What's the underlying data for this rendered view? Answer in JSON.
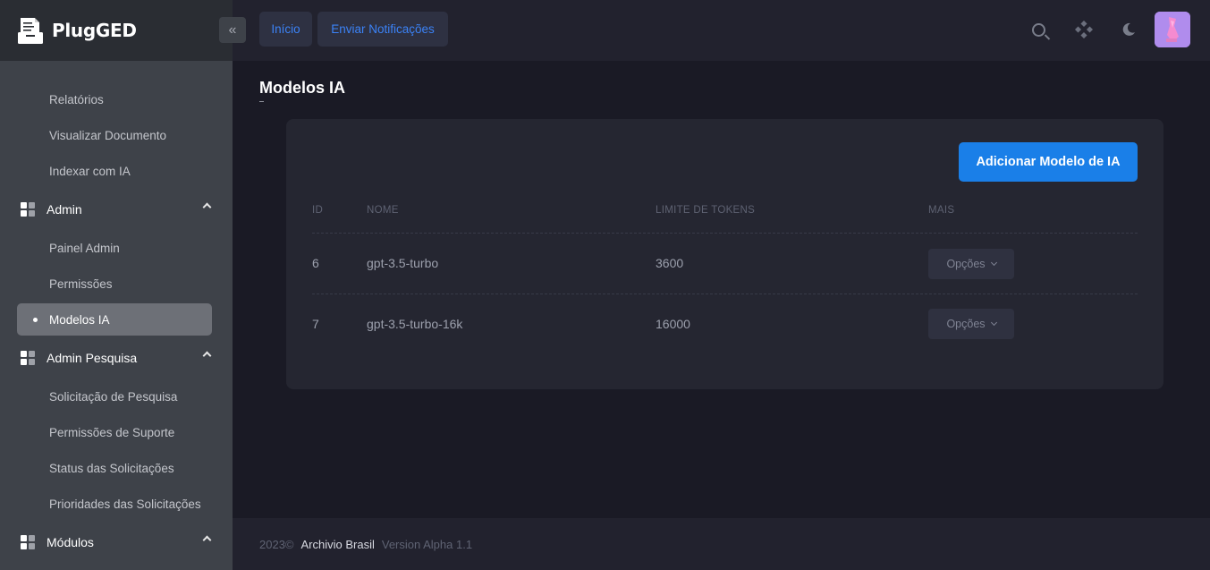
{
  "app": {
    "name": "PlugGED"
  },
  "header": {
    "nav": [
      "Início",
      "Enviar Notificações"
    ],
    "icons": [
      "search-icon",
      "apps-icon",
      "moon-icon",
      "avatar"
    ]
  },
  "sidebar": {
    "items": [
      {
        "type": "sub",
        "label": "Relatórios"
      },
      {
        "type": "sub",
        "label": "Visualizar Documento"
      },
      {
        "type": "sub",
        "label": "Indexar com IA"
      },
      {
        "type": "group",
        "label": "Admin"
      },
      {
        "type": "sub",
        "label": "Painel Admin"
      },
      {
        "type": "sub",
        "label": "Permissões"
      },
      {
        "type": "sub",
        "label": "Modelos IA",
        "active": true
      },
      {
        "type": "group",
        "label": "Admin Pesquisa"
      },
      {
        "type": "sub",
        "label": "Solicitação de Pesquisa"
      },
      {
        "type": "sub",
        "label": "Permissões de Suporte"
      },
      {
        "type": "sub",
        "label": "Status das Solicitações"
      },
      {
        "type": "sub",
        "label": "Prioridades das Solicitações"
      },
      {
        "type": "group",
        "label": "Módulos"
      }
    ]
  },
  "main": {
    "title": "Modelos IA",
    "add_button": "Adicionar Modelo de IA",
    "table": {
      "columns": [
        "ID",
        "NOME",
        "LIMITE DE TOKENS",
        "MAIS"
      ],
      "rows": [
        {
          "id": "6",
          "name": "gpt-3.5-turbo",
          "limit": "3600",
          "action": "Opções"
        },
        {
          "id": "7",
          "name": "gpt-3.5-turbo-16k",
          "limit": "16000",
          "action": "Opções"
        }
      ]
    }
  },
  "footer": {
    "year": "2023©",
    "company": "Archivio Brasil",
    "version": "Version Alpha 1.1"
  },
  "colors": {
    "accent": "#1a7fe8",
    "link": "#3b82f6",
    "sidebar_bg": "#3e4249",
    "content_bg": "#1a1a25"
  }
}
